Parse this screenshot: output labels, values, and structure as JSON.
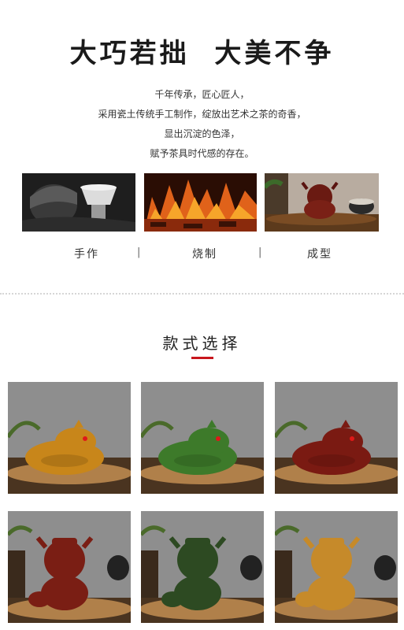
{
  "hero": {
    "title": "大巧若拙  大美不争"
  },
  "intro": {
    "lines": [
      "千年传承，匠心匠人，",
      "采用瓷土传统手工制作，绽放出艺术之茶的奇香，",
      "显出沉淀的色泽，",
      "赋予茶具时代感的存在。"
    ]
  },
  "process": {
    "steps": [
      "手作",
      "烧制",
      "成型"
    ],
    "separator": "|"
  },
  "styles": {
    "title": "款式选择",
    "accent_color": "#c8161d",
    "items": [
      {
        "name": "toad-amber",
        "color": "#c8861a"
      },
      {
        "name": "toad-green",
        "color": "#3d7a2a"
      },
      {
        "name": "toad-red",
        "color": "#7a1a12"
      },
      {
        "name": "ox-red",
        "color": "#7a1e14"
      },
      {
        "name": "ox-green",
        "color": "#2d4a22"
      },
      {
        "name": "ox-amber",
        "color": "#c68a2a"
      }
    ]
  }
}
